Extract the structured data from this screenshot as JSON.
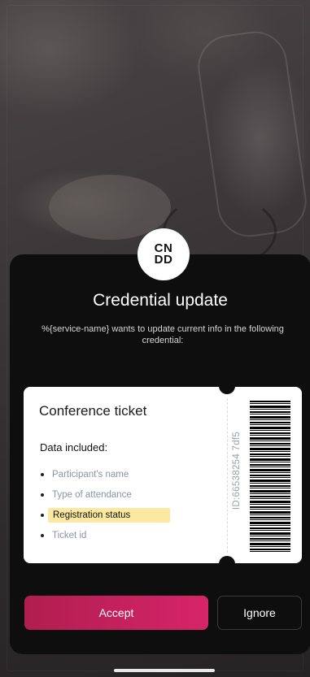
{
  "logo": {
    "text": "CN\nDD"
  },
  "dialog": {
    "title": "Credential update",
    "subtitle": "%{service-name} wants to update current info in the following  credential:"
  },
  "ticket": {
    "title": "Conference ticket",
    "data_label": "Data included:",
    "items": [
      {
        "label": "Participant's name",
        "highlighted": false
      },
      {
        "label": "Type of attendance",
        "highlighted": false
      },
      {
        "label": "Registration status",
        "highlighted": true
      },
      {
        "label": "Ticket id",
        "highlighted": false
      }
    ],
    "id_text": "ID:66538254 7df5"
  },
  "actions": {
    "accept_label": "Accept",
    "ignore_label": "Ignore"
  },
  "colors": {
    "accent_start": "#b01e4e",
    "accent_end": "#d7246a",
    "highlight": "#fbe9a2",
    "sheet": "#0e0e0e"
  }
}
